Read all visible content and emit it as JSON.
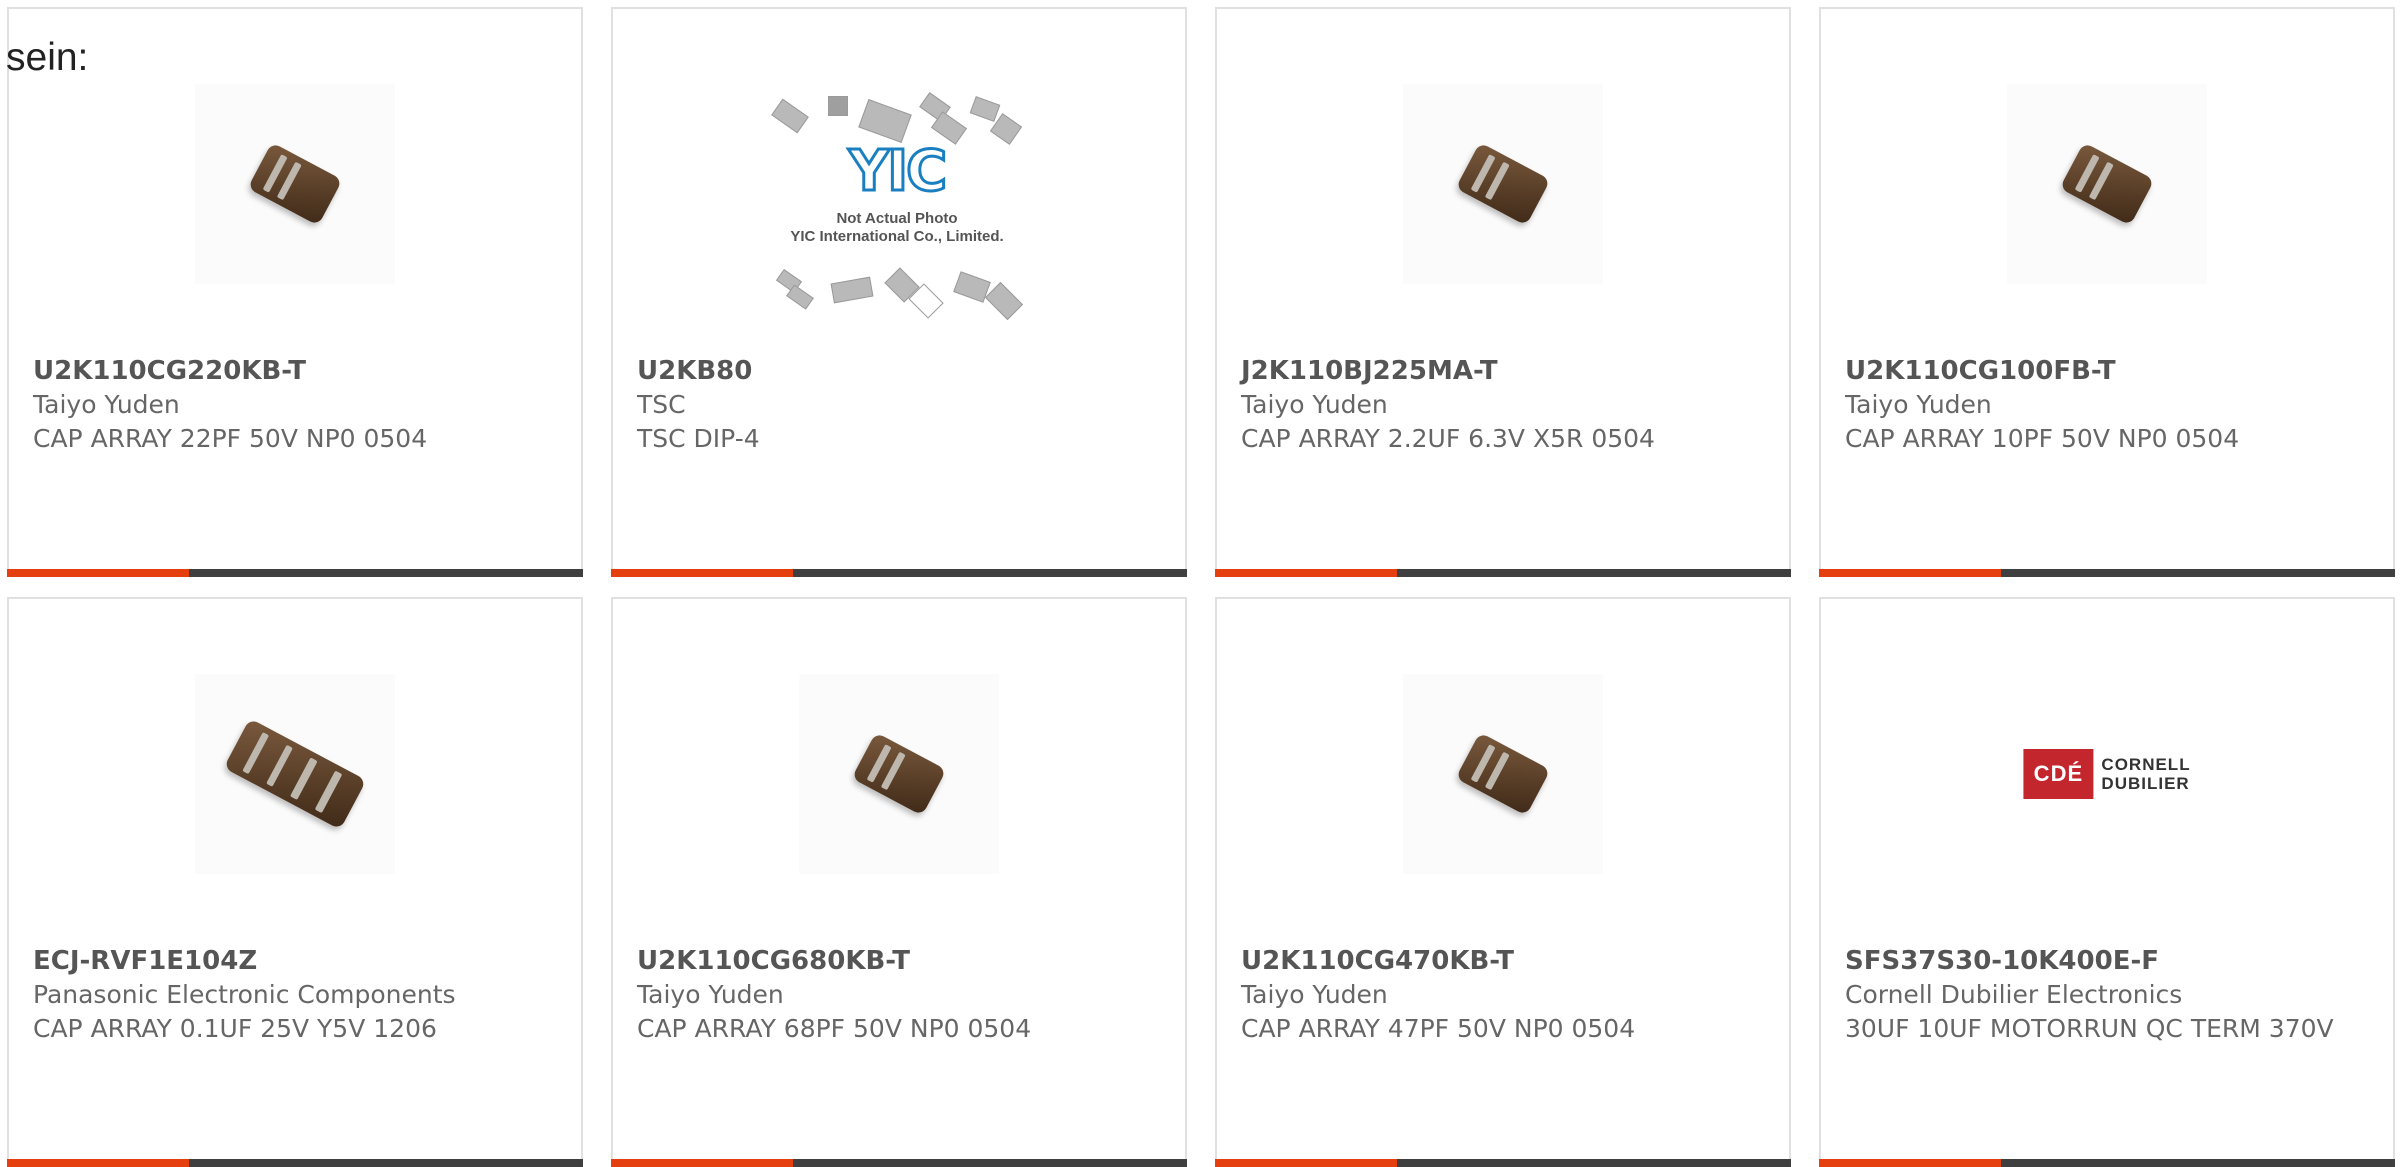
{
  "intro_text": "sein:",
  "colors": {
    "accent": "#e53e0f",
    "bar_dark": "#3f3f3f",
    "border": "#e0e0e0"
  },
  "products": [
    {
      "part_number": "U2K110CG220KB-T",
      "manufacturer": "Taiyo Yuden",
      "description": "CAP ARRAY 22PF 50V NP0 0504",
      "image": "chip-array-icon"
    },
    {
      "part_number": "U2KB80",
      "manufacturer": "TSC",
      "description": "TSC DIP-4",
      "image": "placeholder-image",
      "placeholder": {
        "logo": "YIC",
        "line1": "Not Actual Photo",
        "line2": "YIC International Co., Limited."
      }
    },
    {
      "part_number": "J2K110BJ225MA-T",
      "manufacturer": "Taiyo Yuden",
      "description": "CAP ARRAY 2.2UF 6.3V X5R 0504",
      "image": "chip-array-icon"
    },
    {
      "part_number": "U2K110CG100FB-T",
      "manufacturer": "Taiyo Yuden",
      "description": "CAP ARRAY 10PF 50V NP0 0504",
      "image": "chip-array-icon"
    },
    {
      "part_number": "ECJ-RVF1E104Z",
      "manufacturer": "Panasonic Electronic Components",
      "description": "CAP ARRAY 0.1UF 25V Y5V 1206",
      "image": "chip-array-wide-icon"
    },
    {
      "part_number": "U2K110CG680KB-T",
      "manufacturer": "Taiyo Yuden",
      "description": "CAP ARRAY 68PF 50V NP0 0504",
      "image": "chip-array-icon"
    },
    {
      "part_number": "U2K110CG470KB-T",
      "manufacturer": "Taiyo Yuden",
      "description": "CAP ARRAY 47PF 50V NP0 0504",
      "image": "chip-array-icon"
    },
    {
      "part_number": "SFS37S30-10K400E-F",
      "manufacturer": "Cornell Dubilier Electronics",
      "description": "30UF 10UF MOTORRUN QC TERM 370V",
      "image": "brand-logo",
      "logo": {
        "mark": "CDÉ",
        "line1": "CORNELL",
        "line2": "DUBILIER"
      }
    }
  ]
}
